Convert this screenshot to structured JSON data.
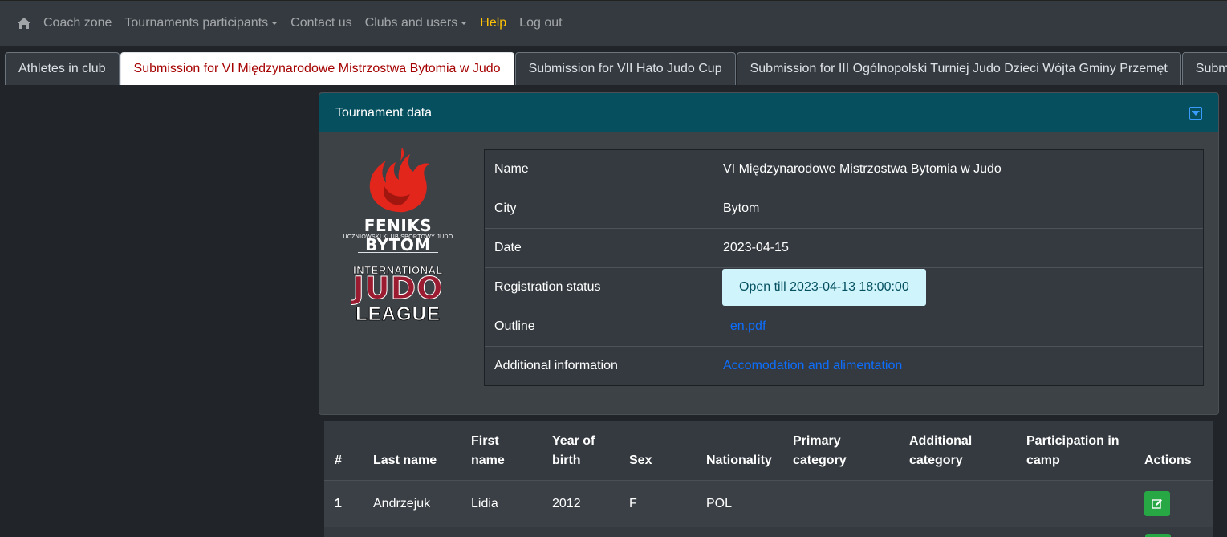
{
  "navbar": {
    "items": [
      {
        "label": "Coach zone",
        "dropdown": false
      },
      {
        "label": "Tournaments participants",
        "dropdown": true
      },
      {
        "label": "Contact us",
        "dropdown": false
      },
      {
        "label": "Clubs and users",
        "dropdown": true
      },
      {
        "label": "Help",
        "dropdown": false
      },
      {
        "label": "Log out",
        "dropdown": false
      }
    ]
  },
  "tabs": [
    {
      "label": "Athletes in club",
      "active": false
    },
    {
      "label": "Submission for VI Międzynarodowe Mistrzostwa Bytomia w Judo",
      "active": true
    },
    {
      "label": "Submission for VII Hato Judo Cup",
      "active": false
    },
    {
      "label": "Submission for III Ogólnopolski Turniej Judo Dzieci Wójta Gminy Przemęt",
      "active": false
    },
    {
      "label": "Submiss",
      "active": false
    }
  ],
  "tournament": {
    "header": "Tournament data",
    "logo": {
      "club_name": "FENIKS BYTOM",
      "club_sub": "UCZNIOWSKI KLUB SPORTOWY JUDO",
      "league_line1": "INTERNATIONAL",
      "league_line2": "JUDO",
      "league_line3": "LEAGUE"
    },
    "rows": {
      "name_label": "Name",
      "name_value": "VI Międzynarodowe Mistrzostwa Bytomia w Judo",
      "city_label": "City",
      "city_value": "Bytom",
      "date_label": "Date",
      "date_value": "2023-04-15",
      "status_label": "Registration status",
      "status_value": "Open till 2023-04-13 18:00:00",
      "outline_label": "Outline",
      "outline_value": "_en.pdf",
      "additional_label": "Additional information",
      "additional_value": "Accomodation and alimentation"
    }
  },
  "athletes": {
    "headers": {
      "num": "#",
      "last_name": "Last name",
      "first_name_1": "First",
      "first_name_2": "name",
      "yob_1": "Year of",
      "yob_2": "birth",
      "sex": "Sex",
      "nationality": "Nationality",
      "primary_1": "Primary",
      "primary_2": "category",
      "additional_1": "Additional",
      "additional_2": "category",
      "camp_1": "Participation in",
      "camp_2": "camp",
      "actions": "Actions"
    },
    "rows": [
      {
        "num": "1",
        "last_name": "Andrzejuk",
        "first_name": "Lidia",
        "yob": "2012",
        "sex": "F",
        "nationality": "POL",
        "primary": "",
        "additional": "",
        "camp": ""
      }
    ]
  },
  "colors": {
    "navbar_bg": "#343a40",
    "card_header_bg": "#054f5e",
    "help": "#ffc107",
    "active_tab_text": "#a50000",
    "link": "#0d6efd",
    "status_bg": "#cff4fc",
    "edit_btn": "#28a745"
  }
}
